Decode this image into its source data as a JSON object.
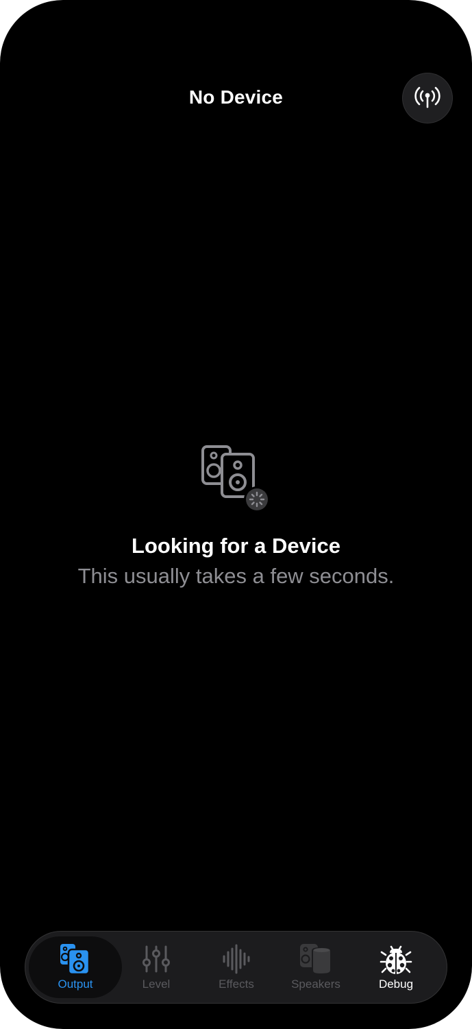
{
  "nav": {
    "title": "No Device",
    "action_icon": "antenna-radiowaves-icon"
  },
  "empty_state": {
    "icon": "speakers-loading-icon",
    "title": "Looking for a Device",
    "subtitle": "This usually takes a few seconds."
  },
  "tabs": [
    {
      "label": "Output",
      "icon": "speaker-icon",
      "state": "selected"
    },
    {
      "label": "Level",
      "icon": "sliders-icon",
      "state": "dimmed"
    },
    {
      "label": "Effects",
      "icon": "waveform-icon",
      "state": "dimmed"
    },
    {
      "label": "Speakers",
      "icon": "speakers-icon",
      "state": "dimmed"
    },
    {
      "label": "Debug",
      "icon": "ladybug-icon",
      "state": "enabled"
    }
  ],
  "colors": {
    "background": "#000000",
    "accent": "#2a92f0",
    "secondary_text": "#8e8e93",
    "dimmed_tab": "#5a5a5e",
    "tabbar": "#1c1c1e"
  }
}
